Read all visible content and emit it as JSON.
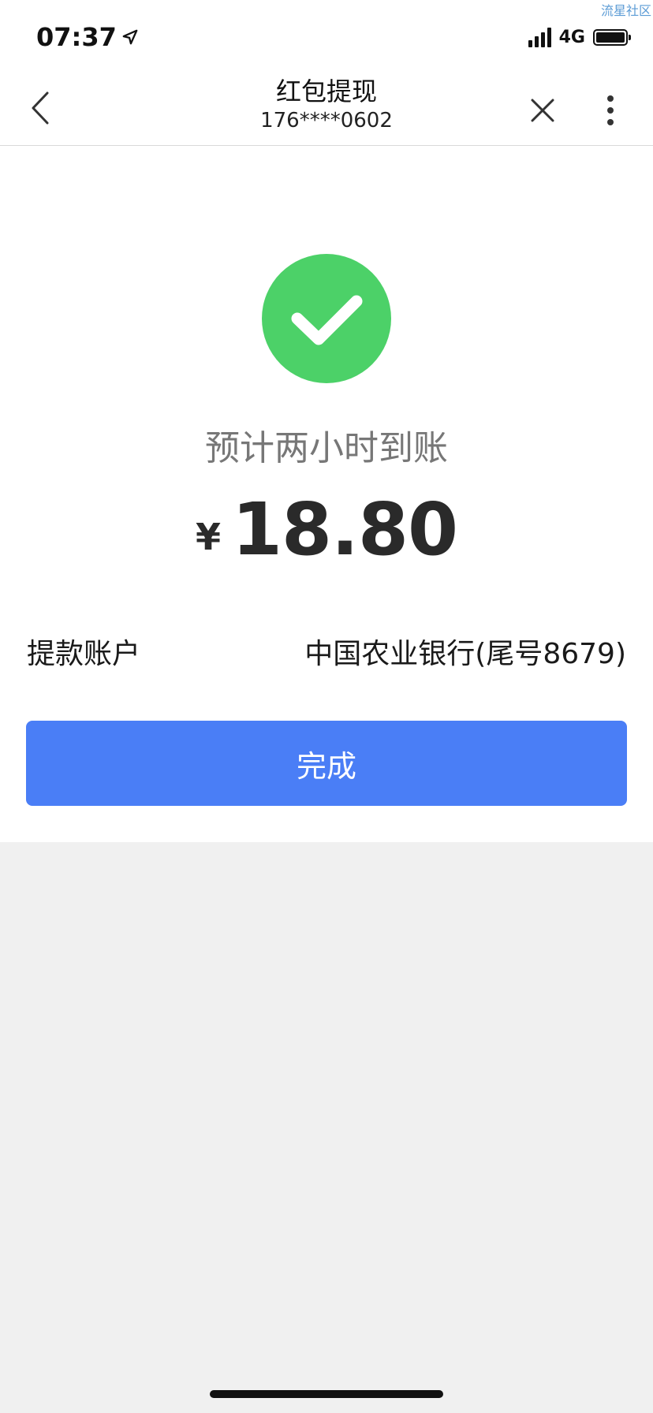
{
  "status_bar": {
    "time": "07:37",
    "network": "4G",
    "watermark": "流星社区"
  },
  "nav": {
    "title": "红包提现",
    "subtitle": "176****0602",
    "back_icon": "chevron-left-icon",
    "close_icon": "close-icon",
    "more_icon": "more-vertical-icon"
  },
  "result": {
    "hint": "预计两小时到账",
    "currency": "¥",
    "amount": "18.80",
    "icon": "check-circle-icon",
    "icon_color": "#4cd168"
  },
  "account": {
    "label": "提款账户",
    "value": "中国农业银行(尾号8679)"
  },
  "done_button": {
    "label": "完成",
    "color": "#4a7ef6"
  }
}
